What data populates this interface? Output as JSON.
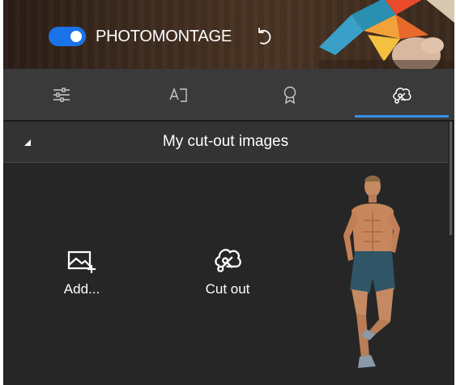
{
  "header": {
    "title": "PHOTOMONTAGE",
    "toggle_on": true,
    "toggle_color": "#1a73e8",
    "undo_icon": "undo-icon"
  },
  "tabs": [
    {
      "icon": "adjustments-sliders-icon",
      "active": false
    },
    {
      "icon": "text-icon",
      "active": false
    },
    {
      "icon": "award-badge-icon",
      "active": false
    },
    {
      "icon": "cut-out-scissors-icon",
      "active": true
    }
  ],
  "accent_color": "#3a8ee6",
  "section": {
    "title": "My cut-out images",
    "expanded": true
  },
  "actions": {
    "add_label": "Add...",
    "cutout_label": "Cut out"
  }
}
